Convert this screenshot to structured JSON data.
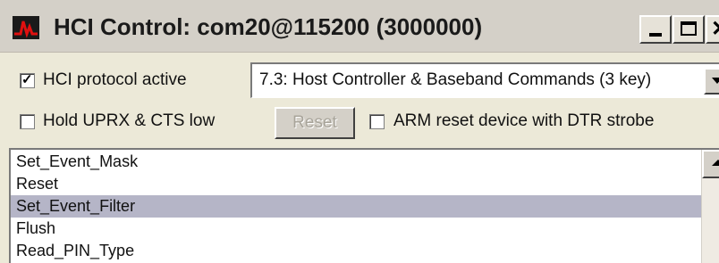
{
  "window": {
    "title": "HCI Control: com20@115200 (3000000)",
    "icon": "waveform-app-icon",
    "title_bar_color": "#d4d0c8"
  },
  "controls": {
    "hci_protocol": {
      "label": "HCI protocol active",
      "checked": true
    },
    "command_group": {
      "selected": "7.3: Host Controller & Baseband Commands (3 key)"
    },
    "hold_uprx": {
      "label": "Hold UPRX & CTS low",
      "checked": false
    },
    "reset_button": {
      "label": "Reset",
      "enabled": false
    },
    "arm_reset": {
      "label": "ARM reset device with DTR strobe",
      "checked": false
    }
  },
  "command_list": {
    "items": [
      "Set_Event_Mask",
      "Reset",
      "Set_Event_Filter",
      "Flush",
      "Read_PIN_Type"
    ],
    "selected_index": 2,
    "selection_color": "#b5b5c7"
  }
}
